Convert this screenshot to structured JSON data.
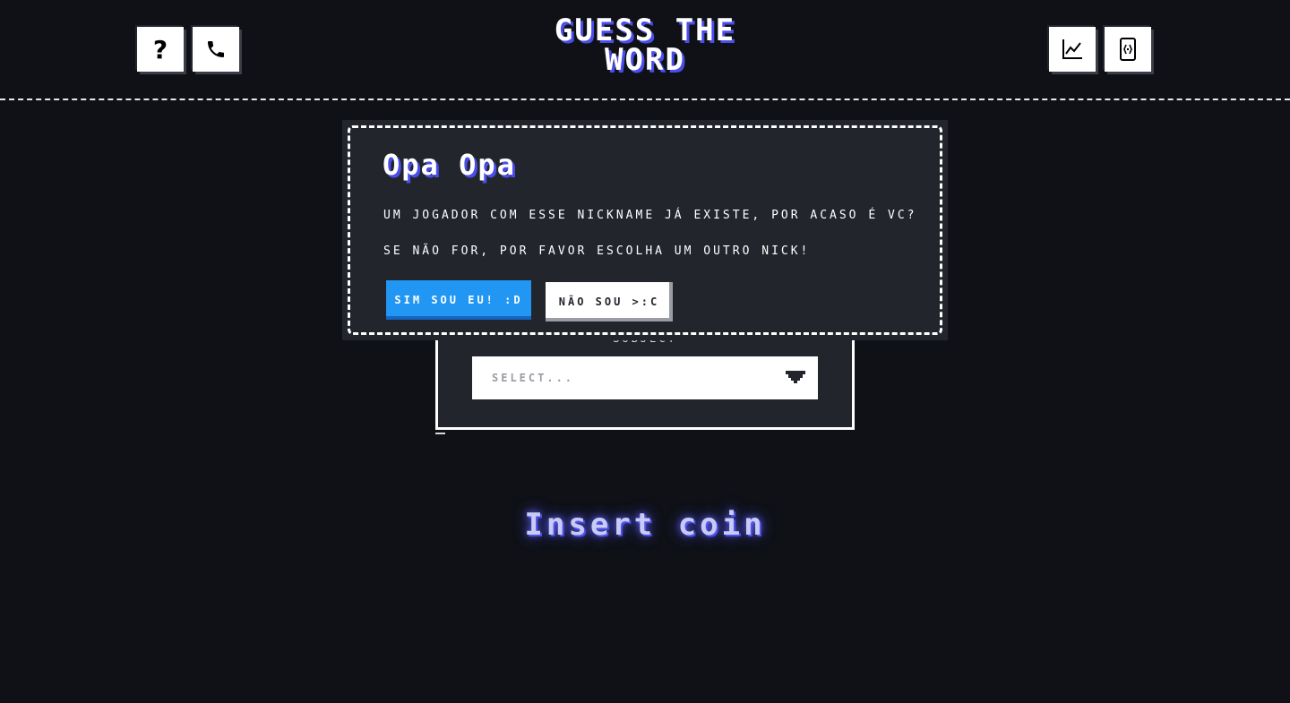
{
  "header": {
    "title_line1": "GUESS THE",
    "title_line2": "WORD",
    "left_buttons": [
      {
        "icon": "question-icon",
        "label": "?"
      },
      {
        "icon": "phone-icon"
      }
    ],
    "right_buttons": [
      {
        "icon": "chart-icon"
      },
      {
        "icon": "phone-device-icon"
      }
    ]
  },
  "form": {
    "label": "SUBJECT",
    "select": {
      "placeholder": "SELECT..."
    }
  },
  "modal": {
    "title": "Opa Opa",
    "line1": "UM JOGADOR COM ESSE NICKNAME JÁ EXISTE, POR ACASO É VC?",
    "line2": "SE NÃO FOR, POR FAVOR ESCOLHA UM OUTRO NICK!",
    "yes_label": "SIM SOU EU! :D",
    "no_label": "NÃO SOU >:C"
  },
  "footer": {
    "insert_coin": "Insert coin"
  },
  "colors": {
    "background": "#0f1117",
    "card": "#22252c",
    "accent_blue": "#2196f3",
    "title_shadow": "#4a4ee8"
  }
}
